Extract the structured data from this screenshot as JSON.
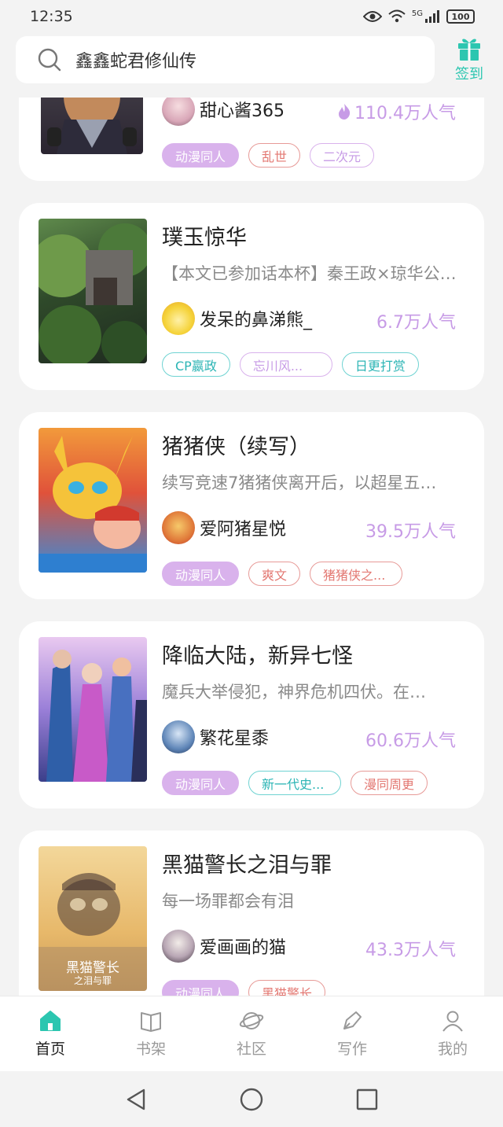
{
  "status_bar": {
    "time": "12:35",
    "network": "5G",
    "battery": "100"
  },
  "search": {
    "query": "鑫鑫蛇君修仙传"
  },
  "checkin": {
    "label": "签到"
  },
  "colors": {
    "accent": "#2cc6b0",
    "popularity": "#c79be6",
    "tag_fill": "#d9b2ec"
  },
  "books": [
    {
      "title": "",
      "description": "",
      "author": "甜心酱365",
      "popularity": "110.4万人气",
      "tags": [
        {
          "label": "动漫同人",
          "style": "fill"
        },
        {
          "label": "乱世",
          "style": "red"
        },
        {
          "label": "二次元",
          "style": "purple"
        }
      ]
    },
    {
      "title": "璞玉惊华",
      "description": "【本文已参加话本杯】秦王政×琼华公…",
      "author": "发呆的鼻涕熊_",
      "popularity": "6.7万人气",
      "tags": [
        {
          "label": "CP嬴政",
          "style": "teal"
        },
        {
          "label": "忘川风...",
          "style": "purple"
        },
        {
          "label": "日更打赏",
          "style": "teal"
        }
      ]
    },
    {
      "title": "猪猪侠（续写）",
      "description": "续写竞速7猪猪侠离开后，以超星五…",
      "author": "爱阿猪星悦",
      "popularity": "39.5万人气",
      "tags": [
        {
          "label": "动漫同人",
          "style": "fill"
        },
        {
          "label": "爽文",
          "style": "red"
        },
        {
          "label": "猪猪侠之...",
          "style": "red"
        }
      ]
    },
    {
      "title": "降临大陆，新异七怪",
      "description": "魔兵大举侵犯，神界危机四伏。在…",
      "author": "繁花星黍",
      "popularity": "60.6万人气",
      "tags": [
        {
          "label": "动漫同人",
          "style": "fill"
        },
        {
          "label": "新一代史...",
          "style": "teal"
        },
        {
          "label": "漫同周更",
          "style": "red"
        }
      ]
    },
    {
      "title": "黑猫警长之泪与罪",
      "description": "每一场罪都会有泪",
      "author": "爱画画的猫",
      "popularity": "43.3万人气",
      "cover_text": "黑猫警长",
      "cover_subtext": "之泪与罪",
      "tags": [
        {
          "label": "动漫同人",
          "style": "fill"
        },
        {
          "label": "黑猫警长",
          "style": "red"
        }
      ]
    }
  ],
  "bottom_nav": [
    {
      "label": "首页",
      "icon": "home-icon",
      "active": true
    },
    {
      "label": "书架",
      "icon": "book-icon",
      "active": false
    },
    {
      "label": "社区",
      "icon": "planet-icon",
      "active": false
    },
    {
      "label": "写作",
      "icon": "pen-icon",
      "active": false
    },
    {
      "label": "我的",
      "icon": "profile-icon",
      "active": false
    }
  ],
  "system_nav": [
    "back-icon",
    "home-circle-icon",
    "recents-icon"
  ]
}
